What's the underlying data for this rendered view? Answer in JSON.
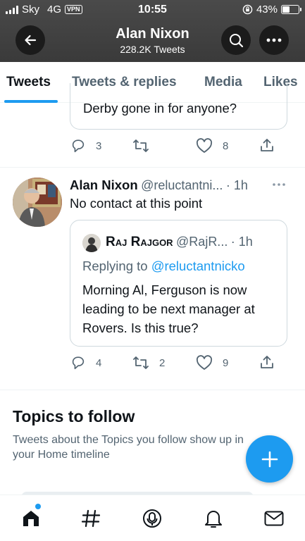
{
  "status": {
    "carrier": "Sky",
    "network": "4G",
    "vpn": "VPN",
    "time": "10:55",
    "battery": "43%"
  },
  "header": {
    "title": "Alan Nixon",
    "subtitle": "228.2K Tweets"
  },
  "tabs": [
    {
      "label": "Tweets"
    },
    {
      "label": "Tweets & replies"
    },
    {
      "label": "Media"
    },
    {
      "label": "Likes"
    }
  ],
  "tweet_prev": {
    "quote_text": "Derby gone in for anyone?",
    "replies": "3",
    "retweets": "",
    "likes": "8"
  },
  "tweet": {
    "author_name": "Alan Nixon",
    "handle": "@reluctantni...",
    "time": "· 1h",
    "text": "No contact at this point",
    "quote": {
      "author_name": "Raj Rajgor",
      "handle": "@RajR...",
      "time": "· 1h",
      "replying_label": "Replying to",
      "replying_to": "@reluctantnicko",
      "text": "Morning Al, Ferguson is now leading to be next manager at Rovers. Is this true?"
    },
    "replies": "4",
    "retweets": "2",
    "likes": "9"
  },
  "topics": {
    "title": "Topics to follow",
    "description": "Tweets about the Topics you follow show up in your Home timeline"
  },
  "nav": [
    "home-icon",
    "explore-icon",
    "spaces-icon",
    "notifications-icon",
    "messages-icon"
  ],
  "colors": {
    "accent": "#1d9bf0",
    "header_bg": "#3f3f3f",
    "text": "#0f1419",
    "secondary": "#536471"
  }
}
